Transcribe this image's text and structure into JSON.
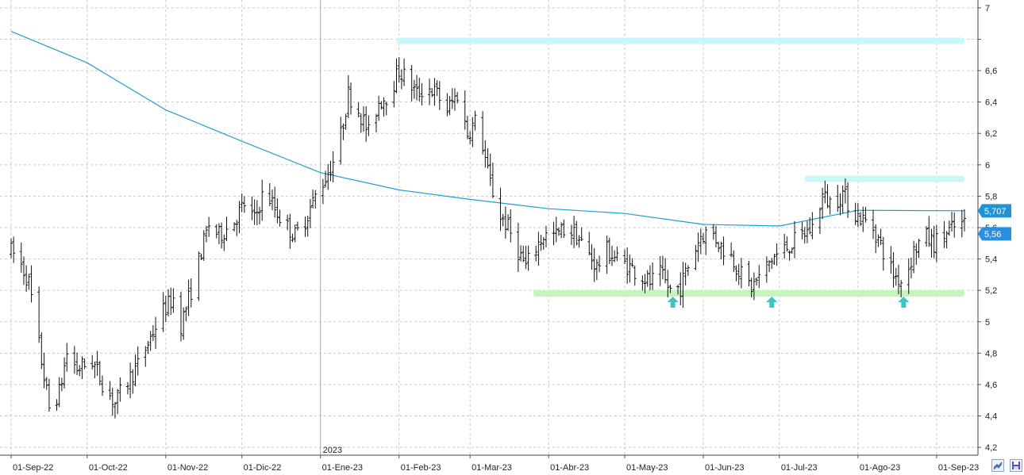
{
  "chart_data": {
    "type": "ohlc",
    "y_axis": {
      "position": "right",
      "ylim": [
        4.15,
        7.05
      ],
      "tick_values": [
        4.2,
        4.4,
        4.6,
        4.8,
        5,
        5.2,
        5.4,
        5.6,
        5.8,
        6,
        6.2,
        6.4,
        6.6,
        6.8,
        7
      ],
      "tick_labels": [
        "4,2",
        "4,4",
        "4,6",
        "4,8",
        "5",
        "5,2",
        "5,4",
        "5,6",
        "5,8",
        "6",
        "6,2",
        "6,4",
        "6,6",
        "",
        "7"
      ],
      "grid": "dashed-horizontal"
    },
    "x_axis": {
      "range": [
        "2022-09-01",
        "2023-09-12"
      ],
      "tick_dates": [
        "2022-09-01",
        "2022-10-01",
        "2022-11-01",
        "2022-12-01",
        "2023-01-01",
        "2023-02-01",
        "2023-03-01",
        "2023-04-01",
        "2023-05-01",
        "2023-06-01",
        "2023-07-01",
        "2023-08-01",
        "2023-09-01"
      ],
      "tick_labels": [
        "01-Sep-22",
        "01-Oct-22",
        "01-Nov-22",
        "01-Dic-22",
        "01-Ene-23",
        "01-Feb-23",
        "01-Mar-23",
        "01-Abr-23",
        "01-May-23",
        "01-Jun-23",
        "01-Jul-23",
        "01-Ago-23",
        "01-Sep-23"
      ],
      "year_marker": {
        "date": "2023-01-01",
        "label": "2023"
      }
    },
    "price_anchors": [
      [
        "2022-09-01",
        5.45
      ],
      [
        "2022-09-04",
        5.4
      ],
      [
        "2022-09-08",
        5.25
      ],
      [
        "2022-09-12",
        4.85
      ],
      [
        "2022-09-16",
        4.45
      ],
      [
        "2022-09-20",
        4.55
      ],
      [
        "2022-09-23",
        4.8
      ],
      [
        "2022-09-27",
        4.7
      ],
      [
        "2022-10-03",
        4.75
      ],
      [
        "2022-10-08",
        4.58
      ],
      [
        "2022-10-12",
        4.48
      ],
      [
        "2022-10-16",
        4.6
      ],
      [
        "2022-10-21",
        4.72
      ],
      [
        "2022-10-26",
        4.9
      ],
      [
        "2022-10-30",
        5.05
      ],
      [
        "2022-11-04",
        5.15
      ],
      [
        "2022-11-07",
        4.98
      ],
      [
        "2022-11-11",
        5.2
      ],
      [
        "2022-11-15",
        5.45
      ],
      [
        "2022-11-18",
        5.62
      ],
      [
        "2022-11-22",
        5.55
      ],
      [
        "2022-11-27",
        5.62
      ],
      [
        "2022-12-02",
        5.75
      ],
      [
        "2022-12-06",
        5.65
      ],
      [
        "2022-12-10",
        5.85
      ],
      [
        "2022-12-14",
        5.72
      ],
      [
        "2022-12-18",
        5.62
      ],
      [
        "2022-12-22",
        5.55
      ],
      [
        "2022-12-26",
        5.65
      ],
      [
        "2022-12-30",
        5.8
      ],
      [
        "2023-01-04",
        5.95
      ],
      [
        "2023-01-08",
        6.1
      ],
      [
        "2023-01-12",
        6.45
      ],
      [
        "2023-01-16",
        6.35
      ],
      [
        "2023-01-20",
        6.2
      ],
      [
        "2023-01-24",
        6.4
      ],
      [
        "2023-01-28",
        6.45
      ],
      [
        "2023-02-01",
        6.6
      ],
      [
        "2023-02-04",
        6.55
      ],
      [
        "2023-02-08",
        6.45
      ],
      [
        "2023-02-12",
        6.5
      ],
      [
        "2023-02-16",
        6.45
      ],
      [
        "2023-02-20",
        6.35
      ],
      [
        "2023-02-24",
        6.45
      ],
      [
        "2023-02-28",
        6.2
      ],
      [
        "2023-03-04",
        6.3
      ],
      [
        "2023-03-08",
        5.95
      ],
      [
        "2023-03-12",
        5.7
      ],
      [
        "2023-03-16",
        5.6
      ],
      [
        "2023-03-20",
        5.45
      ],
      [
        "2023-03-23",
        5.35
      ],
      [
        "2023-03-26",
        5.45
      ],
      [
        "2023-03-30",
        5.55
      ],
      [
        "2023-04-04",
        5.55
      ],
      [
        "2023-04-08",
        5.6
      ],
      [
        "2023-04-12",
        5.55
      ],
      [
        "2023-04-16",
        5.45
      ],
      [
        "2023-04-20",
        5.35
      ],
      [
        "2023-04-24",
        5.45
      ],
      [
        "2023-04-28",
        5.4
      ],
      [
        "2023-05-03",
        5.35
      ],
      [
        "2023-05-07",
        5.3
      ],
      [
        "2023-05-11",
        5.25
      ],
      [
        "2023-05-15",
        5.3
      ],
      [
        "2023-05-19",
        5.2
      ],
      [
        "2023-05-23",
        5.22
      ],
      [
        "2023-05-27",
        5.4
      ],
      [
        "2023-05-31",
        5.55
      ],
      [
        "2023-06-04",
        5.58
      ],
      [
        "2023-06-08",
        5.48
      ],
      [
        "2023-06-12",
        5.42
      ],
      [
        "2023-06-16",
        5.3
      ],
      [
        "2023-06-20",
        5.22
      ],
      [
        "2023-06-24",
        5.3
      ],
      [
        "2023-06-28",
        5.4
      ],
      [
        "2023-07-02",
        5.45
      ],
      [
        "2023-07-06",
        5.5
      ],
      [
        "2023-07-10",
        5.55
      ],
      [
        "2023-07-14",
        5.6
      ],
      [
        "2023-07-18",
        5.8
      ],
      [
        "2023-07-22",
        5.75
      ],
      [
        "2023-07-26",
        5.82
      ],
      [
        "2023-07-30",
        5.7
      ],
      [
        "2023-08-03",
        5.65
      ],
      [
        "2023-08-07",
        5.6
      ],
      [
        "2023-08-11",
        5.45
      ],
      [
        "2023-08-15",
        5.3
      ],
      [
        "2023-08-19",
        5.25
      ],
      [
        "2023-08-23",
        5.45
      ],
      [
        "2023-08-27",
        5.55
      ],
      [
        "2023-08-31",
        5.5
      ],
      [
        "2023-09-04",
        5.55
      ],
      [
        "2023-09-08",
        5.6
      ],
      [
        "2023-09-12",
        5.62
      ]
    ],
    "moving_average": [
      [
        "2022-09-01",
        6.85
      ],
      [
        "2022-10-01",
        6.65
      ],
      [
        "2022-11-01",
        6.35
      ],
      [
        "2022-12-01",
        6.15
      ],
      [
        "2023-01-01",
        5.95
      ],
      [
        "2023-02-01",
        5.84
      ],
      [
        "2023-03-01",
        5.78
      ],
      [
        "2023-04-01",
        5.72
      ],
      [
        "2023-05-01",
        5.69
      ],
      [
        "2023-06-01",
        5.62
      ],
      [
        "2023-07-01",
        5.61
      ],
      [
        "2023-08-01",
        5.71
      ],
      [
        "2023-09-12",
        5.707
      ]
    ],
    "markers": {
      "resistance_top": {
        "from": "2023-01-31",
        "to": "2023-09-12",
        "value": 6.79
      },
      "resistance_july": {
        "from": "2023-07-11",
        "to": "2023-09-12",
        "value": 5.91
      },
      "support": {
        "from": "2023-03-26",
        "to": "2023-09-12",
        "value": 5.18
      },
      "arrows_up": [
        "2023-05-20",
        "2023-06-28",
        "2023-08-19"
      ]
    },
    "last_values": [
      {
        "value": 5.707,
        "label": "5,707"
      },
      {
        "value": 5.56,
        "label": "5,56"
      }
    ],
    "colors": {
      "price_bars": "#111111",
      "moving_average": "#1a9fd0",
      "resistance_band": "#c9f6f8",
      "support_band": "#c3f5bd",
      "arrow": "#3fc4c0",
      "badge_ma": "#1f93d5",
      "badge_price": "#2a8fe0",
      "grid": "#c8c8c8"
    }
  },
  "controls": {
    "left_icon": "chart-toggle-icon",
    "right_icon": "save-disk-icon"
  }
}
